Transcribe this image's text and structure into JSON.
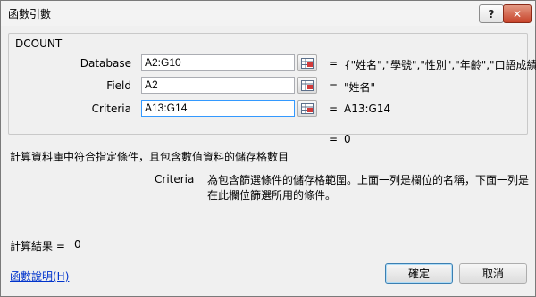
{
  "window": {
    "title": "函數引數",
    "help_btn": "?",
    "close_btn": "✕"
  },
  "function_group": {
    "name": "DCOUNT",
    "args": [
      {
        "label": "Database",
        "value": "A2:G10",
        "result": "{\"姓名\",\"學號\",\"性別\",\"年齡\",\"口語成績"
      },
      {
        "label": "Field",
        "value": "A2",
        "result": "\"姓名\""
      },
      {
        "label": "Criteria",
        "value": "A13:G14",
        "result": "A13:G14"
      }
    ],
    "equals": "="
  },
  "formula_result": "0",
  "function_description": "計算資料庫中符合指定條件，且包含數值資料的儲存格數目",
  "arg_description": {
    "name": "Criteria",
    "text": "為包含篩選條件的儲存格範圍。上面一列是欄位的名稱，下面一列是在此欄位篩選所用的條件。"
  },
  "calc_result": {
    "label": "計算結果 =",
    "value": "0"
  },
  "help_link": "函數說明(H)",
  "buttons": {
    "ok": "確定",
    "cancel": "取消"
  },
  "icons": {
    "ref_button": "range-select-icon"
  }
}
